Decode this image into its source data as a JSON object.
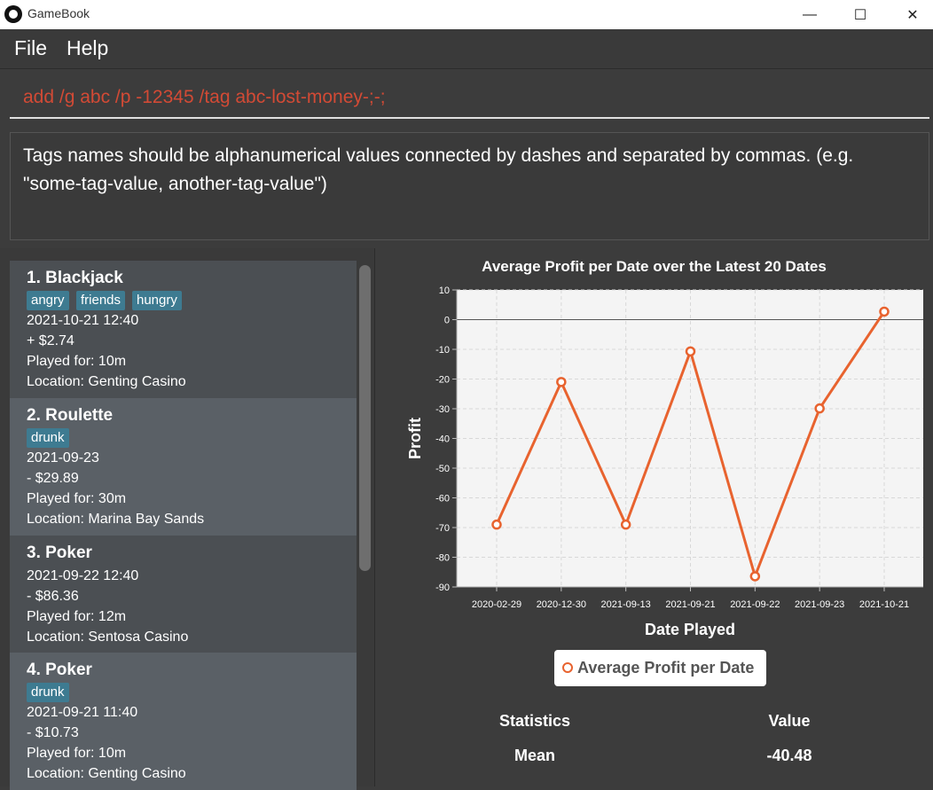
{
  "window": {
    "title": "GameBook",
    "minimize": "—",
    "maximize": "☐",
    "close": "✕"
  },
  "menu": {
    "file": "File",
    "help": "Help"
  },
  "command": {
    "text": "add /g abc /p -12345 /tag abc-lost-money-;-;"
  },
  "result": {
    "text": "Tags names should be alphanumerical values connected by dashes and separated by commas. (e.g. \"some-tag-value, another-tag-value\")"
  },
  "games": [
    {
      "title": "1.  Blackjack",
      "tags": [
        "angry",
        "friends",
        "hungry"
      ],
      "datetime": "2021-10-21 12:40",
      "profit": "+ $2.74",
      "duration": "Played for: 10m",
      "location": "Location: Genting Casino"
    },
    {
      "title": "2.  Roulette",
      "tags": [
        "drunk"
      ],
      "datetime": "2021-09-23",
      "profit": "- $29.89",
      "duration": "Played for: 30m",
      "location": "Location: Marina Bay Sands"
    },
    {
      "title": "3.  Poker",
      "tags": [],
      "datetime": "2021-09-22 12:40",
      "profit": "- $86.36",
      "duration": "Played for: 12m",
      "location": "Location: Sentosa Casino"
    },
    {
      "title": "4.  Poker",
      "tags": [
        "drunk"
      ],
      "datetime": "2021-09-21 11:40",
      "profit": "- $10.73",
      "duration": "Played for: 10m",
      "location": "Location: Genting Casino"
    }
  ],
  "chart_data": {
    "type": "line",
    "title": "Average Profit per Date over the Latest 20 Dates",
    "xlabel": "Date Played",
    "ylabel": "Profit",
    "categories": [
      "2020-02-29",
      "2020-12-30",
      "2021-09-13",
      "2021-09-21",
      "2021-09-22",
      "2021-09-23",
      "2021-10-21"
    ],
    "series": [
      {
        "name": "Average Profit per Date",
        "values": [
          -69,
          -21,
          -69,
          -10.7,
          -86.4,
          -29.9,
          2.7
        ]
      }
    ],
    "ylim": [
      -90,
      10
    ],
    "yticks": [
      10,
      0,
      -10,
      -20,
      -30,
      -40,
      -50,
      -60,
      -70,
      -80,
      -90
    ],
    "grid": true,
    "legend": "bottom",
    "color": "#e8632f"
  },
  "statistics": {
    "header_stat": "Statistics",
    "header_value": "Value",
    "rows": [
      {
        "label": "Mean",
        "value": "-40.48"
      }
    ]
  }
}
